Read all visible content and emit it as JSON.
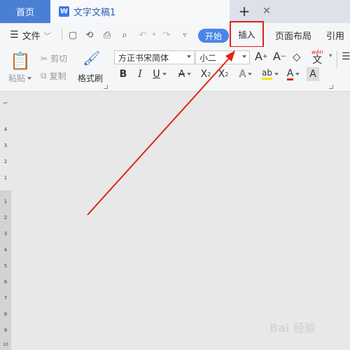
{
  "tabs": {
    "home": "首页",
    "doc_title": "文字文稿1",
    "doc_icon": "W"
  },
  "menu": {
    "file": "文件",
    "start": "开始",
    "insert": "插入",
    "layout": "页面布局",
    "reference": "引用"
  },
  "ribbon": {
    "paste": "粘贴",
    "cut": "剪切",
    "copy": "复制",
    "format_painter": "格式刷",
    "font_name": "方正书宋简体",
    "font_size": "小二",
    "wen": "wén"
  },
  "ruler": {
    "numbers_top": [
      "4",
      "3",
      "2",
      "1"
    ],
    "numbers_bottom": [
      "1",
      "2",
      "3",
      "4",
      "5",
      "6",
      "7",
      "8",
      "9",
      "10"
    ]
  },
  "watermark": "Bai 经验",
  "colors": {
    "accent": "#4a86e8",
    "annotation_red": "#e0241b",
    "home_tab": "#4a7fd6"
  }
}
